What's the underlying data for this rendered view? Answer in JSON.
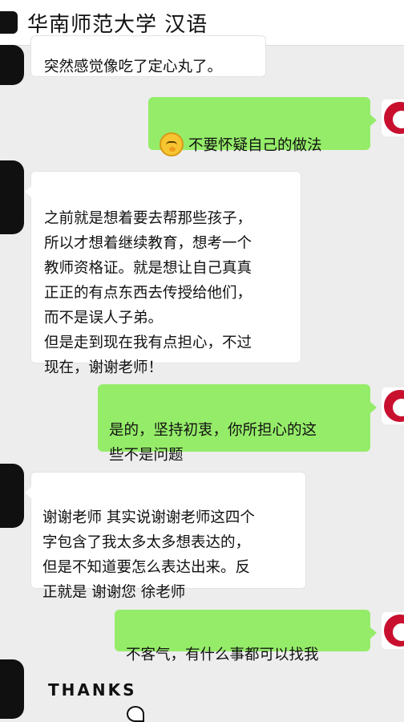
{
  "header": {
    "title": "华南师范大学 汉语"
  },
  "messages": [
    {
      "side": "in",
      "text": "突然感觉像吃了定心丸了。"
    },
    {
      "side": "out",
      "emoji": "thinking-emoji",
      "text": "不要怀疑自己的做法"
    },
    {
      "side": "in",
      "text": "之前就是想着要去帮那些孩子，\n所以才想着继续教育，想考一个\n教师资格证。就是想让自己真真\n正正的有点东西去传授给他们，\n而不是误人子弟。\n但是走到现在我有点担心，不过\n现在，谢谢老师！"
    },
    {
      "side": "out",
      "text": "是的，坚持初衷，你所担心的这\n些不是问题"
    },
    {
      "side": "in",
      "text": "谢谢老师 其实说谢谢老师这四个\n字包含了我太多太多想表达的，\n但是不知道要怎么表达出来。反\n正就是   谢谢您   徐老师"
    },
    {
      "side": "out",
      "text": "不客气，有什么事都可以找我"
    },
    {
      "side": "in",
      "sticker": "THANKS"
    }
  ],
  "colors": {
    "outgoing_bubble": "#95ec69",
    "incoming_bubble": "#ffffff",
    "background": "#ededed",
    "avatar_logo": "#c8102e"
  }
}
